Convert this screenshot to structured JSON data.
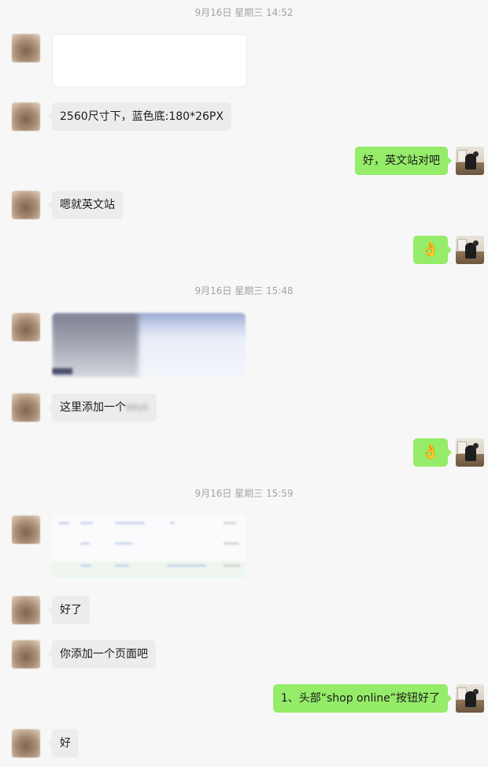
{
  "chat": {
    "timestamps": [
      "9月16日 星期三 14:52",
      "9月16日 星期三 15:48",
      "9月16日 星期三 15:59"
    ],
    "messages": {
      "m1": "2560尺寸下，蓝色底:180*26PX",
      "m2": "好，英文站对吧",
      "m3": "嗯就英文站",
      "m4": "👌",
      "m5_prefix": "这里添加一个",
      "m5_blurred": "Wish",
      "m6": "👌",
      "m7": "好了",
      "m8": "你添加一个页面吧",
      "m9": "1、头部“shop online”按钮好了",
      "m10": "好"
    }
  },
  "colors": {
    "background": "#f7f7f7",
    "incoming_bubble": "#ececec",
    "outgoing_bubble": "#95ec69",
    "timestamp_text": "#a3a3a3"
  },
  "icons": [
    "avatar-contact",
    "avatar-self",
    "ok-hand-emoji"
  ]
}
